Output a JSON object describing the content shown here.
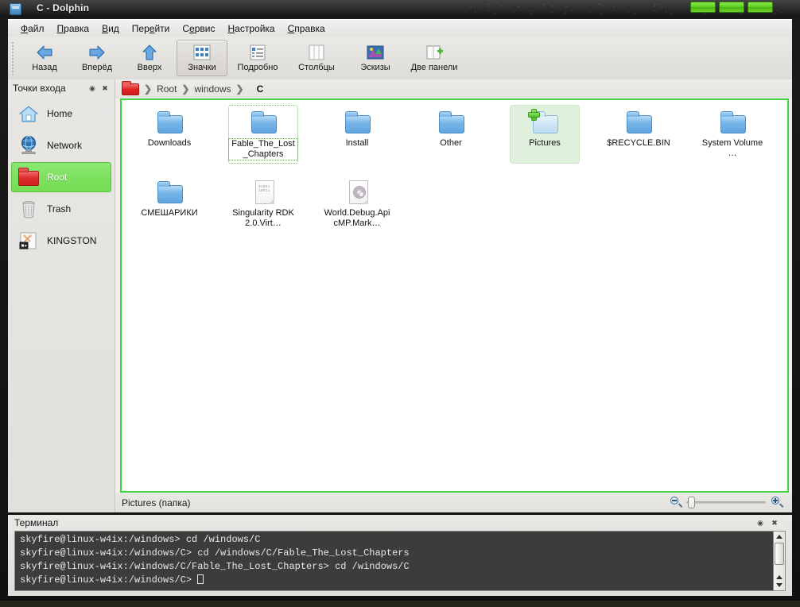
{
  "window": {
    "title": "C - Dolphin",
    "app_icon": "folder-app-icon",
    "buttons": {
      "minimize": "minimize-button",
      "maximize": "maximize-button",
      "close": "close-button"
    }
  },
  "menubar": [
    {
      "label": "Файл",
      "mnemonic": "Ф"
    },
    {
      "label": "Правка",
      "mnemonic": "П"
    },
    {
      "label": "Вид",
      "mnemonic": "В"
    },
    {
      "label": "Перейти",
      "mnemonic": "е"
    },
    {
      "label": "Сервис",
      "mnemonic": "е"
    },
    {
      "label": "Настройка",
      "mnemonic": "Н"
    },
    {
      "label": "Справка",
      "mnemonic": "С"
    }
  ],
  "toolbar": [
    {
      "label": "Назад",
      "icon": "arrow-left-icon",
      "active": false
    },
    {
      "label": "Вперёд",
      "icon": "arrow-right-icon",
      "active": false
    },
    {
      "label": "Вверх",
      "icon": "arrow-up-icon",
      "active": false
    },
    {
      "label": "Значки",
      "icon": "view-icons-icon",
      "active": true
    },
    {
      "label": "Подробно",
      "icon": "view-details-icon",
      "active": false
    },
    {
      "label": "Столбцы",
      "icon": "view-columns-icon",
      "active": false
    },
    {
      "label": "Эскизы",
      "icon": "preview-thumbnail-icon",
      "active": false
    },
    {
      "label": "Две панели",
      "icon": "split-view-icon",
      "active": false
    }
  ],
  "sidebar": {
    "title": "Точки входа",
    "header_icons": {
      "configure": "gear-icon",
      "close": "close-icon"
    },
    "items": [
      {
        "label": "Home",
        "icon": "home-icon",
        "selected": false
      },
      {
        "label": "Network",
        "icon": "network-globe-icon",
        "selected": false
      },
      {
        "label": "Root",
        "icon": "folder-red-icon",
        "selected": true
      },
      {
        "label": "Trash",
        "icon": "trash-icon",
        "selected": false
      },
      {
        "label": "KINGSTON",
        "icon": "usb-drive-icon",
        "selected": false
      }
    ]
  },
  "breadcrumb": {
    "root_icon": "folder-red-icon",
    "separator": "›",
    "items": [
      {
        "label": "Root",
        "current": false
      },
      {
        "label": "windows",
        "current": false
      },
      {
        "label": "C",
        "current": true
      }
    ]
  },
  "files": [
    {
      "name": "Downloads",
      "icon": "folder-icon",
      "state": "normal"
    },
    {
      "name": "Fable_The_Lost_Chapters",
      "icon": "folder-icon",
      "state": "focused"
    },
    {
      "name": "Install",
      "icon": "folder-icon",
      "state": "normal"
    },
    {
      "name": "Other",
      "icon": "folder-icon",
      "state": "normal"
    },
    {
      "name": "Pictures",
      "icon": "folder-add-icon",
      "state": "hovered"
    },
    {
      "name": "$RECYCLE.BIN",
      "icon": "folder-icon",
      "state": "normal"
    },
    {
      "name": "System Volume …",
      "icon": "folder-icon",
      "state": "normal"
    },
    {
      "name": "СМЕШАРИКИ",
      "icon": "folder-icon",
      "state": "normal"
    },
    {
      "name": "Singularity RDK 2.0.Virt…",
      "icon": "binary-file-icon",
      "state": "normal"
    },
    {
      "name": "World.Debug.ApicMP.Mark…",
      "icon": "disc-image-file-icon",
      "state": "normal"
    }
  ],
  "statusbar": {
    "text": "Pictures (папка)",
    "zoom_out_icon": "zoom-out-icon",
    "zoom_in_icon": "zoom-in-icon",
    "slider_value": 2
  },
  "terminal": {
    "title": "Терминал",
    "header_icons": {
      "configure": "gear-icon",
      "close": "close-icon"
    },
    "lines": [
      "skyfire@linux-w4ix:/windows> cd /windows/C",
      "skyfire@linux-w4ix:/windows/C> cd /windows/C/Fable_The_Lost_Chapters",
      "skyfire@linux-w4ix:/windows/C/Fable_The_Lost_Chapters> cd /windows/C",
      "skyfire@linux-w4ix:/windows/C> "
    ]
  },
  "colors": {
    "selection_green": "#7ee15f",
    "view_border_green": "#3fd33f",
    "window_button_green": "#5ecb1c",
    "folder_blue": "#74b3e8",
    "root_red": "#e02424",
    "terminal_bg": "#3c3c3c"
  }
}
